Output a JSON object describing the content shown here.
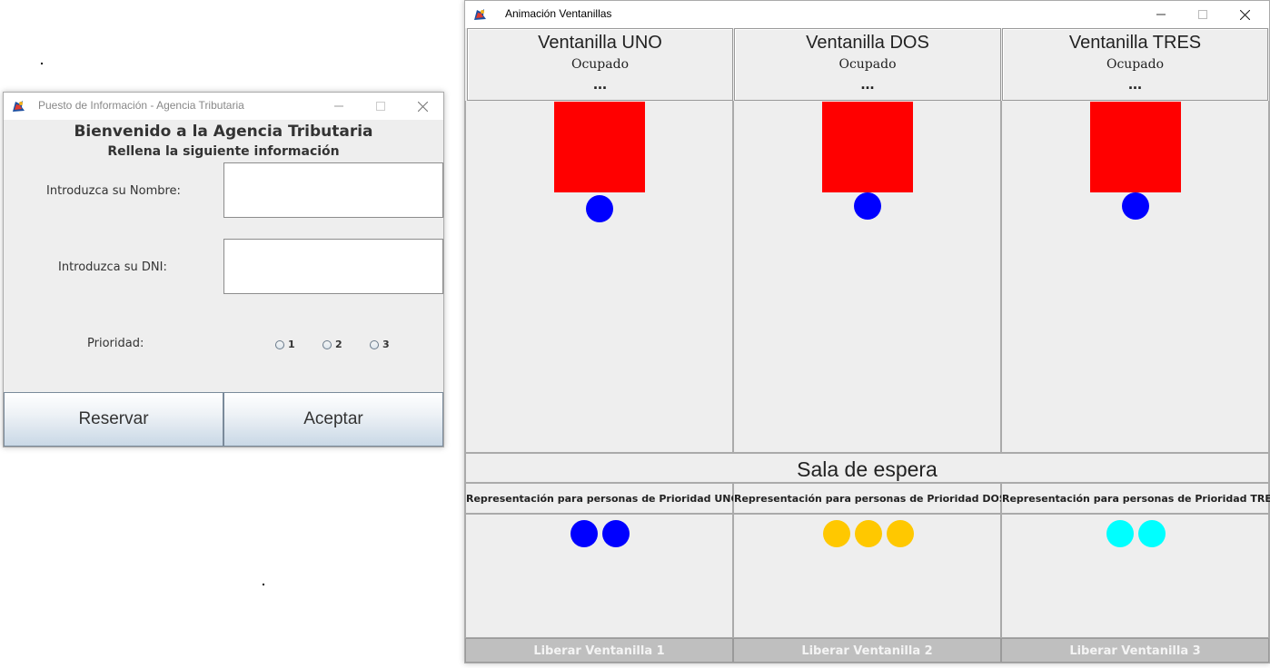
{
  "info_window": {
    "title": "Puesto de Información - Agencia Tributaria",
    "heading": "Bienvenido a la Agencia Tributaria",
    "subheading": "Rellena la siguiente información",
    "name_label": "Introduzca su Nombre:",
    "name_value": "",
    "dni_label": "Introduzca su DNI:",
    "dni_value": "",
    "priority_label": "Prioridad:",
    "priority_options": [
      "1",
      "2",
      "3"
    ],
    "reserve_button": "Reservar",
    "accept_button": "Aceptar"
  },
  "animation_window": {
    "title": "Animación Ventanillas",
    "windows": [
      {
        "title": "Ventanilla UNO",
        "status": "Ocupado",
        "dots": "...",
        "desk_color": "#ff0000",
        "person_color": "#0000ff"
      },
      {
        "title": "Ventanilla DOS",
        "status": "Ocupado",
        "dots": "...",
        "desk_color": "#ff0000",
        "person_color": "#0000ff"
      },
      {
        "title": "Ventanilla TRES",
        "status": "Ocupado",
        "dots": "...",
        "desk_color": "#ff0000",
        "person_color": "#0000ff"
      }
    ],
    "waiting_room_title": "Sala de espera",
    "priority_groups": [
      {
        "label": "Representación para personas de Prioridad UNO",
        "waiting_count": 2,
        "color": "#0000ff"
      },
      {
        "label": "Representación para personas de Prioridad DOS",
        "waiting_count": 3,
        "color": "#ffc800"
      },
      {
        "label": "Representación para personas de Prioridad TRES",
        "waiting_count": 2,
        "color": "#00ffff"
      }
    ],
    "release_buttons": [
      "Liberar Ventanilla 1",
      "Liberar Ventanilla 2",
      "Liberar Ventanilla 3"
    ]
  },
  "icons": {
    "app_icon": "java-app-icon",
    "minimize": "minimize-icon",
    "maximize": "maximize-icon",
    "close": "close-icon"
  }
}
